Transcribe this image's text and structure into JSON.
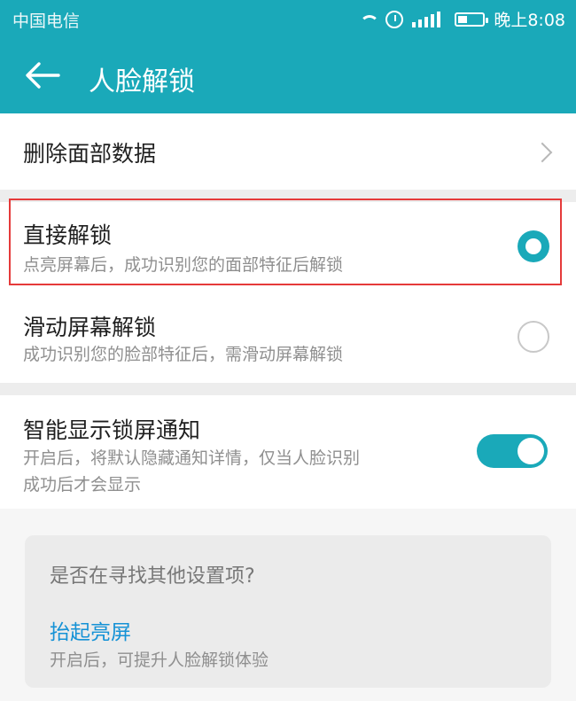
{
  "status": {
    "carrier": "中国电信",
    "time": "晚上8:08"
  },
  "appbar": {
    "title": "人脸解锁"
  },
  "items": {
    "delete_face": "删除面部数据",
    "direct_unlock": {
      "title": "直接解锁",
      "subtitle": "点亮屏幕后，成功识别您的面部特征后解锁",
      "selected": true
    },
    "swipe_unlock": {
      "title": "滑动屏幕解锁",
      "subtitle": "成功识别您的脸部特征后，需滑动屏幕解锁",
      "selected": false
    },
    "smart_notify": {
      "title": "智能显示锁屏通知",
      "subtitle_line1": "开启后，将默认隐藏通知详情，仅当人脸识别",
      "subtitle_line2": "成功后才会显示",
      "enabled": true
    }
  },
  "suggestion": {
    "question": "是否在寻找其他设置项?",
    "link": "抬起亮屏",
    "desc": "开启后，可提升人脸解锁体验"
  },
  "colors": {
    "accent": "#1aa9b9",
    "highlight": "#e53a3a",
    "link": "#1592d6"
  }
}
